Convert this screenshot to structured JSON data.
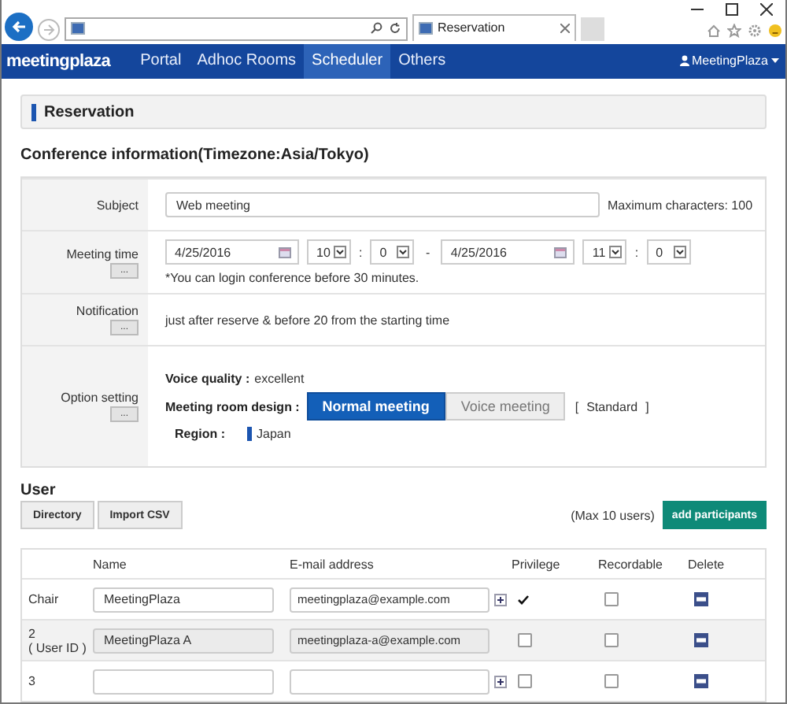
{
  "browser": {
    "tab_title": "Reservation"
  },
  "nav": {
    "logo": "meetingplaza",
    "items": [
      {
        "label": "Portal",
        "selected": false
      },
      {
        "label": "Adhoc Rooms",
        "selected": false
      },
      {
        "label": "Scheduler",
        "selected": true
      },
      {
        "label": "Others",
        "selected": false
      }
    ],
    "user": "MeetingPlaza"
  },
  "page_title": "Reservation",
  "section_title": "Conference information(Timezone:Asia/Tokyo)",
  "form": [
    {
      "kind": "subject",
      "label": "Subject",
      "value": "Web meeting",
      "hint": "Maximum characters: 100"
    },
    {
      "kind": "time",
      "label": "Meeting time",
      "button": "...",
      "start_date": "4/25/2016",
      "start_hour": "10",
      "start_min": "0",
      "dash": "-",
      "colon": ":",
      "end_date": "4/25/2016",
      "end_hour": "11",
      "end_min": "0",
      "note": "*You can login conference before 30 minutes."
    },
    {
      "kind": "notification",
      "label": "Notification",
      "button": "...",
      "text": "just after reserve & before 20 from the starting time"
    },
    {
      "kind": "options",
      "label": "Option setting",
      "button": "...",
      "voice_label": "Voice quality :",
      "voice_value": "excellent",
      "design_label": "Meeting room design :",
      "designs": [
        {
          "label": "Normal meeting",
          "selected": true
        },
        {
          "label": "Voice meeting",
          "selected": false
        }
      ],
      "bracket_open": "[",
      "design_value": "Standard",
      "bracket_close": "]",
      "region_label": "Region :",
      "region": "Japan"
    }
  ],
  "users": {
    "title": "User",
    "buttons": [
      "Directory",
      "Import CSV"
    ],
    "max_note": "(Max 10 users)",
    "add_button": "add participants",
    "columns": [
      "Name",
      "E-mail address",
      "Privilege",
      "Recordable",
      "Delete"
    ],
    "rows": [
      {
        "label": "Chair",
        "sub": "",
        "name": "MeetingPlaza",
        "email": "meetingplaza@example.com",
        "readonly": false,
        "plus": true,
        "privilege": {
          "kind": "mark",
          "checked": true
        },
        "recordable": false
      },
      {
        "label": "2",
        "sub": "( User ID )",
        "name": "MeetingPlaza A",
        "email": "meetingplaza-a@example.com",
        "readonly": true,
        "plus": false,
        "privilege": {
          "kind": "box",
          "checked": false
        },
        "recordable": false
      },
      {
        "label": "3",
        "sub": "",
        "name": "",
        "email": "",
        "readonly": false,
        "plus": true,
        "privilege": {
          "kind": "box",
          "checked": false
        },
        "recordable": false
      }
    ]
  }
}
